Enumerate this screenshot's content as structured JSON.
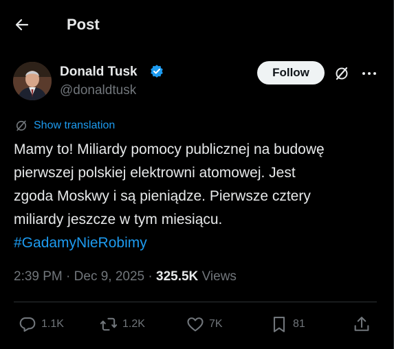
{
  "header": {
    "title": "Post"
  },
  "author": {
    "name": "Donald Tusk",
    "handle": "@donaldtusk"
  },
  "follow_label": "Follow",
  "translation": {
    "label": "Show translation"
  },
  "post": {
    "lines": [
      "Mamy to! Miliardy pomocy publicznej na budowę",
      "pierwszej polskiej elektrowni atomowej. Jest",
      "zgoda Moskwy i są pieniądze. Pierwsze cztery",
      "miliardy jeszcze w tym miesiącu."
    ],
    "hashtag": "#GadamyNieRobimy"
  },
  "meta": {
    "time": "2:39 PM",
    "separator": "·",
    "date": "Dec 9, 2025",
    "views": "325.5K",
    "views_label": "Views"
  },
  "actions": {
    "replies": "1.1K",
    "reposts": "1.2K",
    "likes": "7K",
    "bookmarks": "81"
  },
  "colors": {
    "background": "#000000",
    "text": "#e7e9ea",
    "muted": "#71767b",
    "accent": "#1d9bf0",
    "divider": "#2f3336"
  }
}
